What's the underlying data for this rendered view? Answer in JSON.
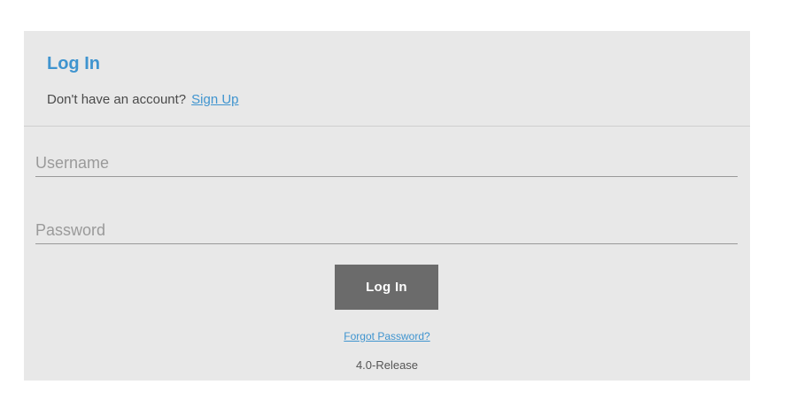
{
  "header": {
    "title": "Log In",
    "account_prompt": "Don't have an account?",
    "signup_link": "Sign Up"
  },
  "form": {
    "username": {
      "value": "",
      "placeholder": "Username"
    },
    "password": {
      "value": "",
      "placeholder": "Password"
    },
    "submit_label": "Log In"
  },
  "footer": {
    "forgot_password_link": "Forgot Password?",
    "version": "4.0-Release"
  },
  "colors": {
    "accent": "#3f94cf",
    "card_background": "#e8e8e8",
    "button_background": "#6b6b6b"
  }
}
